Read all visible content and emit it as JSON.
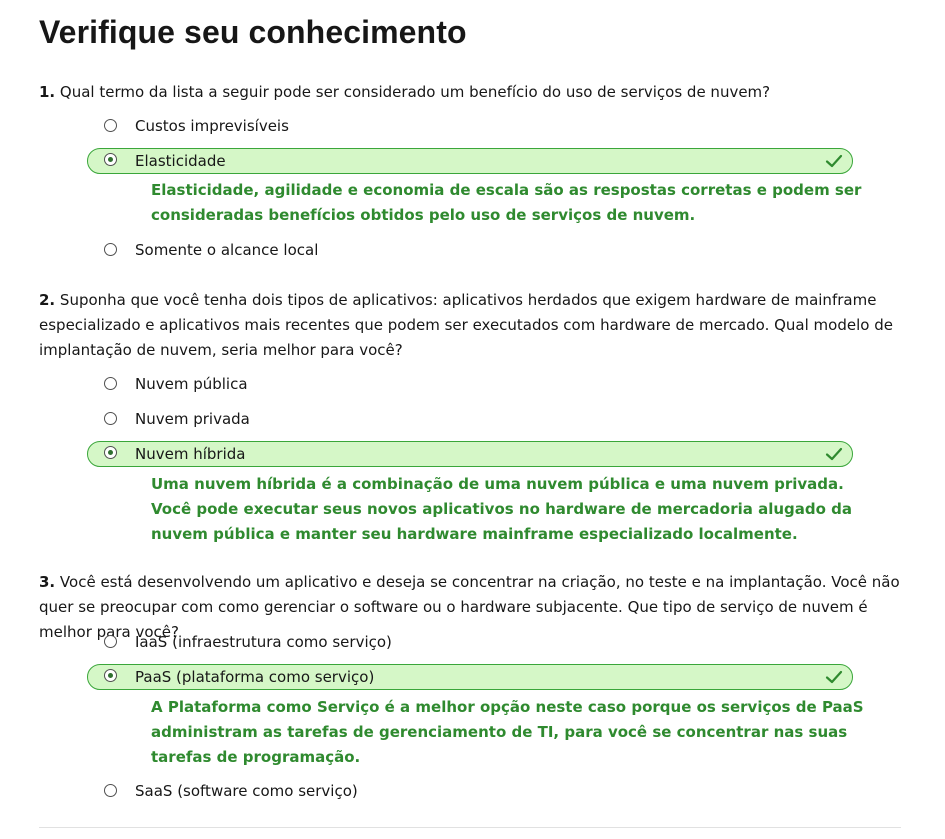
{
  "page_title": "Verifique seu conhecimento",
  "colors": {
    "correct_background": "#d5f7c7",
    "correct_border": "#3aa63a",
    "explanation_text": "#2f8a2f"
  },
  "questions": [
    {
      "number": "1.",
      "text": "Qual termo da lista a seguir pode ser considerado um benefício do uso de serviços de nuvem?",
      "choices": [
        {
          "label": "Custos imprevisíveis",
          "selected": false
        },
        {
          "label": "Elasticidade",
          "selected": true,
          "correct": true,
          "icon": "checkmark-icon"
        },
        {
          "label": "Somente o alcance local",
          "selected": false
        }
      ],
      "explanation": "Elasticidade, agilidade e economia de escala são as respostas corretas e podem ser consideradas benefícios obtidos pelo uso de serviços de nuvem."
    },
    {
      "number": "2.",
      "text": "Suponha que você tenha dois tipos de aplicativos: aplicativos herdados que exigem hardware de mainframe especializado e aplicativos mais recentes que podem ser executados com hardware de mercado. Qual modelo de implantação de nuvem, seria melhor para você?",
      "choices": [
        {
          "label": "Nuvem pública",
          "selected": false
        },
        {
          "label": "Nuvem privada",
          "selected": false
        },
        {
          "label": "Nuvem híbrida",
          "selected": true,
          "correct": true,
          "icon": "checkmark-icon"
        }
      ],
      "explanation": "Uma nuvem híbrida é a combinação de uma nuvem pública e uma nuvem privada. Você pode executar seus novos aplicativos no hardware de mercadoria alugado da nuvem pública e manter seu hardware mainframe especializado localmente."
    },
    {
      "number": "3.",
      "text": "Você está desenvolvendo um aplicativo e deseja se concentrar na criação, no teste e na implantação. Você não quer se preocupar com como gerenciar o software ou o hardware subjacente. Que tipo de serviço de nuvem é melhor para você?",
      "choices": [
        {
          "label": "IaaS (infraestrutura como serviço)",
          "selected": false
        },
        {
          "label": "PaaS (plataforma como serviço)",
          "selected": true,
          "correct": true,
          "icon": "checkmark-icon"
        },
        {
          "label": "SaaS (software como serviço)",
          "selected": false
        }
      ],
      "explanation": "A Plataforma como Serviço é a melhor opção neste caso porque os serviços de PaaS administram as tarefas de gerenciamento de TI, para você se concentrar nas suas tarefas de programação."
    }
  ]
}
